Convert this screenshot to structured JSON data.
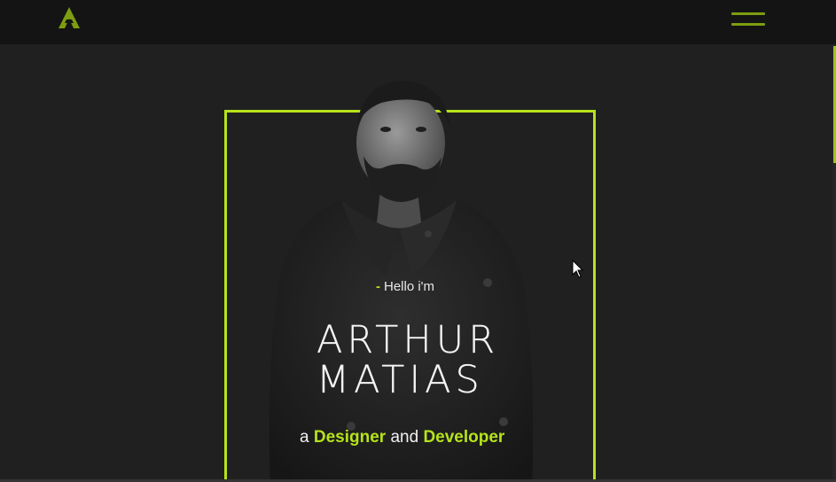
{
  "header": {
    "logo_icon": "a-logo-icon",
    "menu_icon": "hamburger-menu-icon"
  },
  "hero": {
    "greeting_dash": "-",
    "greeting": "Hello i'm",
    "name_line1": "ARTHUR",
    "name_line2": "MATIAS",
    "tagline_prefix": "a",
    "tagline_role1": "Designer",
    "tagline_conjunction": "and",
    "tagline_role2": "Developer"
  },
  "colors": {
    "accent": "#b6e31a",
    "background": "#202020",
    "header_background": "#141414"
  }
}
